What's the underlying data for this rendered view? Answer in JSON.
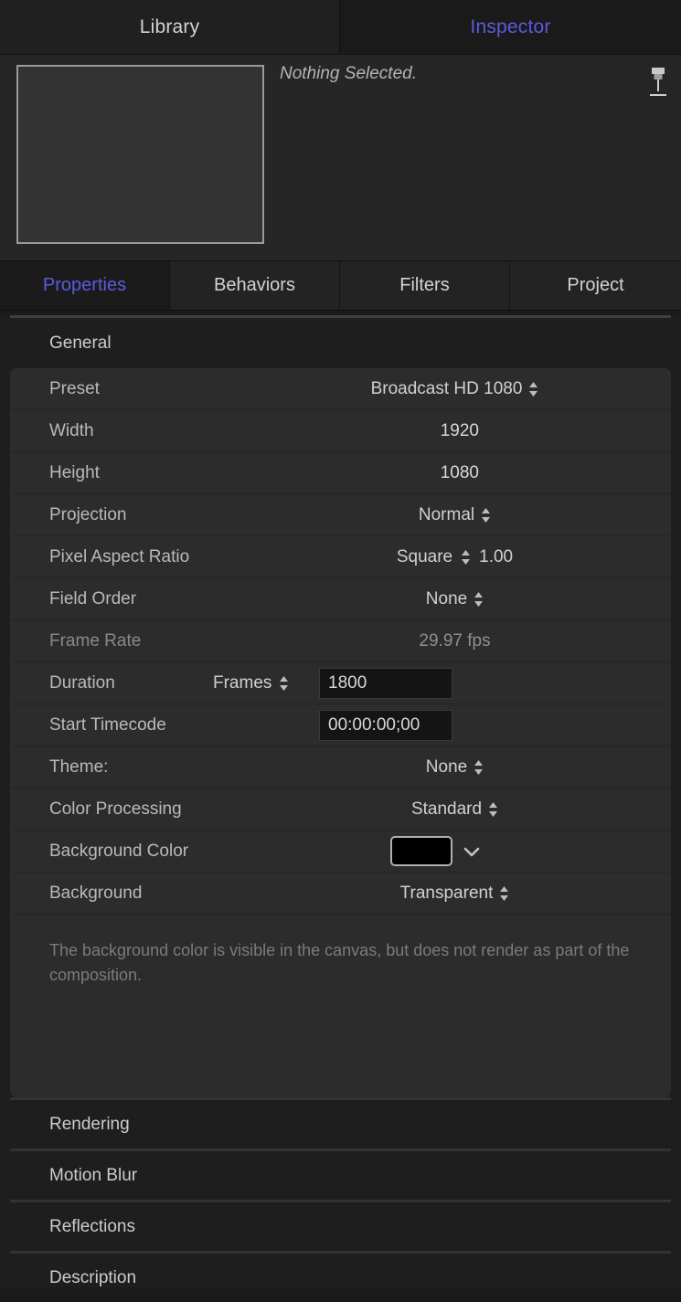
{
  "window_tabs": [
    {
      "label": "Library",
      "active": false
    },
    {
      "label": "Inspector",
      "active": true
    }
  ],
  "preview": {
    "status_text": "Nothing Selected.",
    "pin_icon": "pin-icon",
    "thumbnail": "empty-preview-thumbnail"
  },
  "inspector_tabs": [
    {
      "label": "Properties",
      "active": true
    },
    {
      "label": "Behaviors",
      "active": false
    },
    {
      "label": "Filters",
      "active": false
    },
    {
      "label": "Project",
      "active": false
    }
  ],
  "general": {
    "title": "General",
    "rows": {
      "preset": {
        "label": "Preset",
        "value": "Broadcast HD 1080"
      },
      "width": {
        "label": "Width",
        "value": "1920"
      },
      "height": {
        "label": "Height",
        "value": "1080"
      },
      "projection": {
        "label": "Projection",
        "value": "Normal"
      },
      "pixel_aspect_ratio": {
        "label": "Pixel Aspect Ratio",
        "value": "Square",
        "numeric": "1.00"
      },
      "field_order": {
        "label": "Field Order",
        "value": "None"
      },
      "frame_rate": {
        "label": "Frame Rate",
        "value": "29.97 fps"
      },
      "duration": {
        "label": "Duration",
        "unit": "Frames",
        "value": "1800"
      },
      "start_timecode": {
        "label": "Start Timecode",
        "value": "00:00:00;00"
      },
      "theme": {
        "label": "Theme:",
        "value": "None"
      },
      "color_processing": {
        "label": "Color Processing",
        "value": "Standard"
      },
      "background_color": {
        "label": "Background Color",
        "swatch_color": "#000000"
      },
      "background": {
        "label": "Background",
        "value": "Transparent"
      }
    },
    "help_text": "The background color is visible in the canvas, but does not render as part of the composition."
  },
  "sections": [
    {
      "label": "Rendering"
    },
    {
      "label": "Motion Blur"
    },
    {
      "label": "Reflections"
    },
    {
      "label": "Description"
    }
  ],
  "colors": {
    "accent": "#5b5bdd",
    "panel": "#2c2c2c",
    "background": "#1e1e1e"
  }
}
